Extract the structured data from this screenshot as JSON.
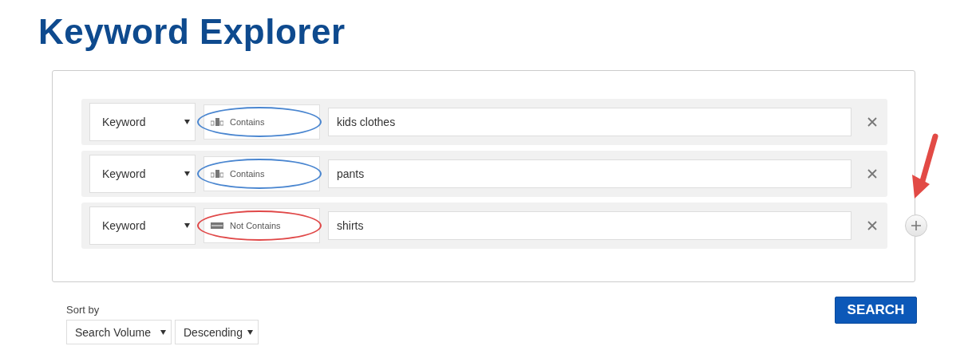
{
  "title": "Keyword Explorer",
  "filters": [
    {
      "field": "Keyword",
      "operator": {
        "kind": "contains",
        "label": "Contains"
      },
      "value": "kids clothes",
      "color": "#4a86d0"
    },
    {
      "field": "Keyword",
      "operator": {
        "kind": "contains",
        "label": "Contains"
      },
      "value": "pants",
      "color": "#4a86d0"
    },
    {
      "field": "Keyword",
      "operator": {
        "kind": "not-contains",
        "label": "Not Contains"
      },
      "value": "shirts",
      "color": "#e04848"
    }
  ],
  "sort": {
    "label": "Sort by",
    "field": "Search Volume",
    "order": "Descending"
  },
  "search_button": "SEARCH"
}
